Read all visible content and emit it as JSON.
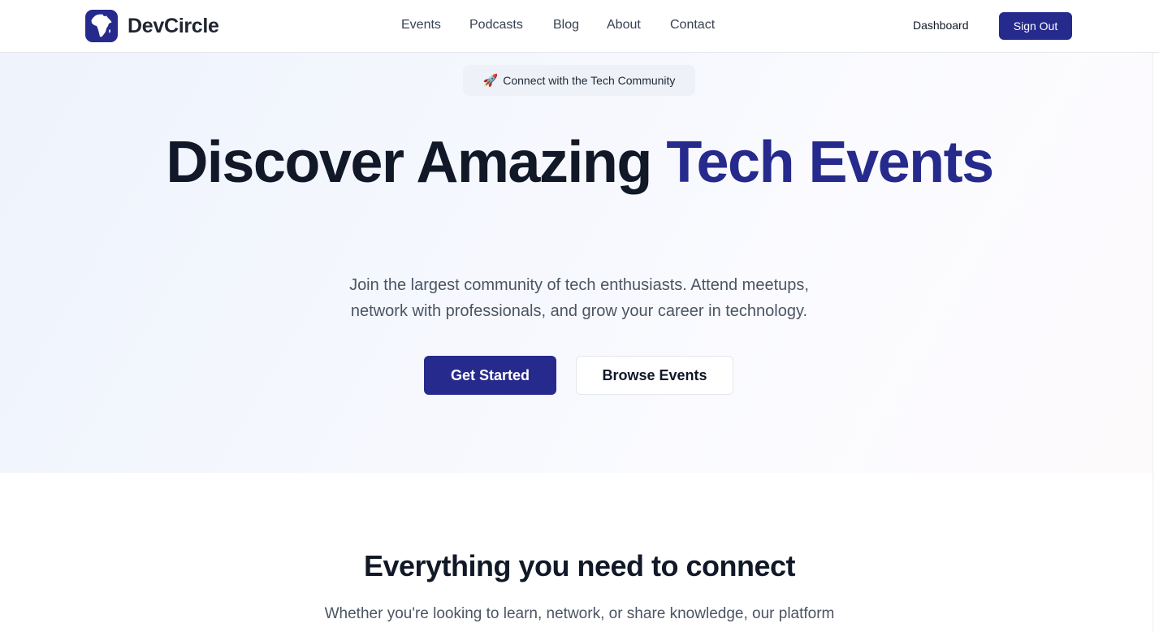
{
  "nav": {
    "brand": "DevCircle",
    "links": [
      "Events",
      "Podcasts",
      "Blog",
      "About",
      "Contact"
    ],
    "dashboard_label": "Dashboard",
    "signout_label": "Sign Out"
  },
  "hero": {
    "badge_icon": "🚀",
    "badge_text": "Connect with the Tech Community",
    "title_part1": "Discover Amazing ",
    "title_accent": "Tech Events",
    "subtitle_line1": "Join the largest community of tech enthusiasts. Attend meetups,",
    "subtitle_line2": "network with professionals, and grow your career in technology.",
    "primary_cta": "Get Started",
    "secondary_cta": "Browse Events"
  },
  "features": {
    "title": "Everything you need to connect",
    "subtitle": "Whether you're looking to learn, network, or share knowledge, our platform"
  },
  "colors": {
    "brand": "#262a8c",
    "text_dark": "#111827",
    "text_muted": "#4b5563"
  },
  "icons": {
    "logo": "africa-map-icon",
    "badge": "rocket-icon"
  }
}
